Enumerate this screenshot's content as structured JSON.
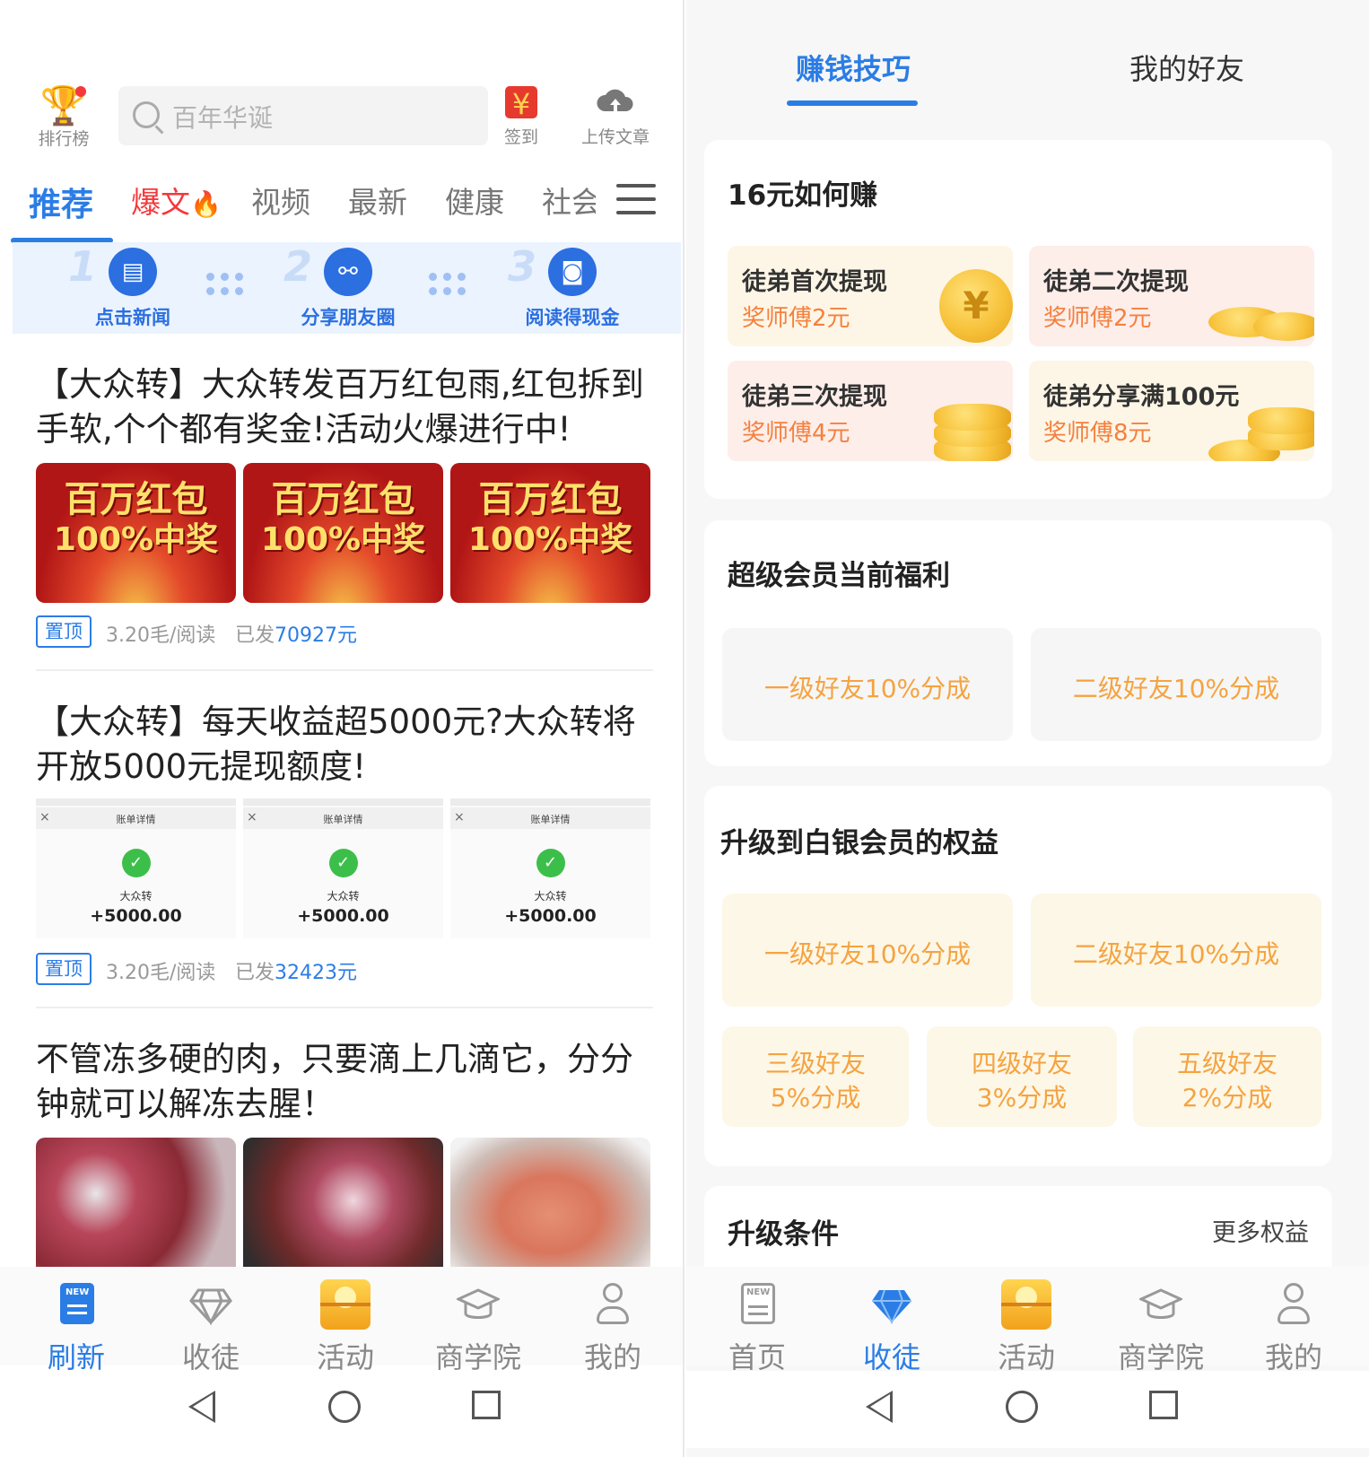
{
  "left": {
    "header": {
      "rank_label": "排行榜",
      "search_placeholder": "百年华诞",
      "checkin_label": "签到",
      "checkin_glyph": "¥",
      "upload_label": "上传文章"
    },
    "tabs": [
      {
        "label": "推荐",
        "active": true
      },
      {
        "label": "爆文",
        "hot": true
      },
      {
        "label": "视频"
      },
      {
        "label": "最新"
      },
      {
        "label": "健康"
      },
      {
        "label": "社会"
      }
    ],
    "steps": [
      {
        "num": "1",
        "label": "点击新闻",
        "icon": "news-icon"
      },
      {
        "num": "2",
        "label": "分享朋友圈",
        "icon": "share-icon"
      },
      {
        "num": "3",
        "label": "阅读得现金",
        "icon": "cash-icon"
      }
    ],
    "articles": [
      {
        "title": "【大众转】大众转发百万红包雨,红包拆到手软,个个都有奖金!活动火爆进行中!",
        "image_type": "hongbao",
        "image_line1": "百万红包",
        "image_line2": "100%中奖",
        "pin": "置顶",
        "rate": "3.20毛/阅读",
        "sent_prefix": "已发",
        "sent_amount": "70927元"
      },
      {
        "title": "【大众转】每天收益超5000元?大众转将开放5000元提现额度!",
        "image_type": "bill",
        "bill_title": "账单详情",
        "bill_name": "大众转",
        "bill_amount": "+5000.00",
        "pin": "置顶",
        "rate": "3.20毛/阅读",
        "sent_prefix": "已发",
        "sent_amount": "32423元"
      },
      {
        "title": "不管冻多硬的肉，只要滴上几滴它，分分钟就可以解冻去腥！",
        "image_type": "meat"
      }
    ],
    "bottom_nav": [
      {
        "label": "刷新",
        "icon": "news-icon",
        "active": true
      },
      {
        "label": "收徒",
        "icon": "diamond-icon"
      },
      {
        "label": "活动",
        "icon": "chest-icon"
      },
      {
        "label": "商学院",
        "icon": "cap-icon"
      },
      {
        "label": "我的",
        "icon": "user-icon"
      }
    ]
  },
  "right": {
    "tabs": [
      {
        "label": "赚钱技巧",
        "active": true
      },
      {
        "label": "我的好友"
      }
    ],
    "earn": {
      "title": "16元如何赚",
      "tips": [
        {
          "title": "徒弟首次提现",
          "reward": "奖师傅2元",
          "coin_glyph": "¥"
        },
        {
          "title": "徒弟二次提现",
          "reward": "奖师傅2元"
        },
        {
          "title": "徒弟三次提现",
          "reward": "奖师傅4元"
        },
        {
          "title": "徒弟分享满100元",
          "reward": "奖师傅8元"
        }
      ]
    },
    "super_member": {
      "title": "超级会员当前福利",
      "benefits": [
        "一级好友10%分成",
        "二级好友10%分成"
      ]
    },
    "silver": {
      "title": "升级到白银会员的权益",
      "benefits": [
        "一级好友10%分成",
        "二级好友10%分成"
      ],
      "small_benefits": [
        {
          "line1": "三级好友",
          "line2": "5%分成"
        },
        {
          "line1": "四级好友",
          "line2": "3%分成"
        },
        {
          "line1": "五级好友",
          "line2": "2%分成"
        }
      ]
    },
    "upgrade": {
      "title": "升级条件",
      "more": "更多权益"
    },
    "bottom_nav": [
      {
        "label": "首页",
        "icon": "news-icon"
      },
      {
        "label": "收徒",
        "icon": "diamond-icon",
        "active": true
      },
      {
        "label": "活动",
        "icon": "chest-icon"
      },
      {
        "label": "商学院",
        "icon": "cap-icon"
      },
      {
        "label": "我的",
        "icon": "user-icon"
      }
    ]
  },
  "colors": {
    "accent": "#2b7de6",
    "hot": "#f5383b",
    "orange": "#f5803e",
    "gold": "#f5a340"
  }
}
